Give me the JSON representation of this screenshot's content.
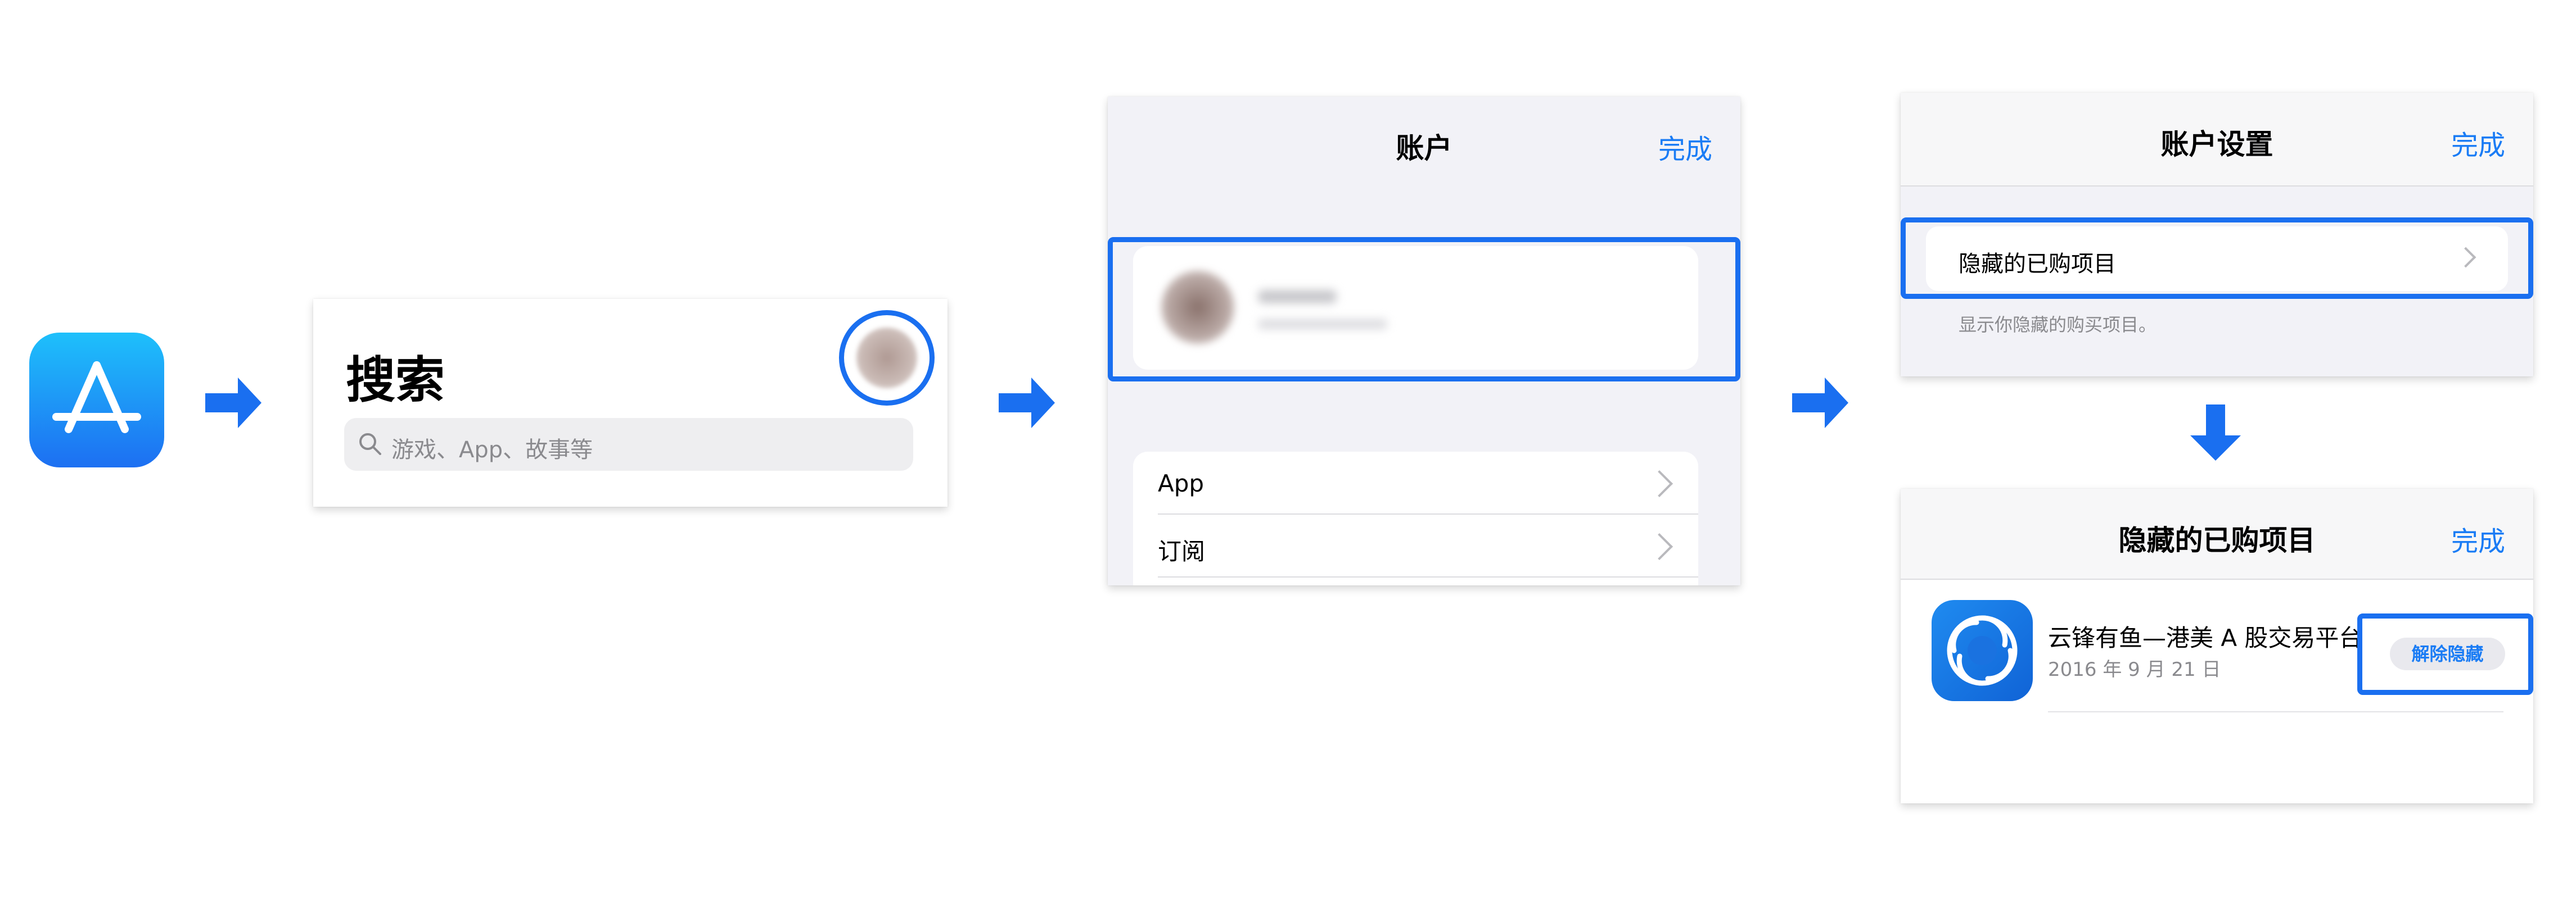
{
  "colors": {
    "accent": "#1a7cf5",
    "highlight": "#1a6ff0",
    "grouped_bg": "#f2f2f7"
  },
  "app_store_icon": {
    "name": "app-store-icon"
  },
  "search_panel": {
    "title": "搜索",
    "search_placeholder": "游戏、App、故事等"
  },
  "account_panel": {
    "nav_title": "账户",
    "done_label": "完成",
    "menu_items": [
      {
        "label": "App"
      },
      {
        "label": "订阅"
      }
    ]
  },
  "settings_panel": {
    "nav_title": "账户设置",
    "done_label": "完成",
    "hidden_purchases_label": "隐藏的已购项目",
    "hidden_purchases_caption": "显示你隐藏的购买项目。"
  },
  "hidden_panel": {
    "nav_title": "隐藏的已购项目",
    "done_label": "完成",
    "app_name": "云锋有鱼—港美 A 股交易平台",
    "app_date": "2016 年 9 月 21 日",
    "unhide_label": "解除隐藏"
  }
}
